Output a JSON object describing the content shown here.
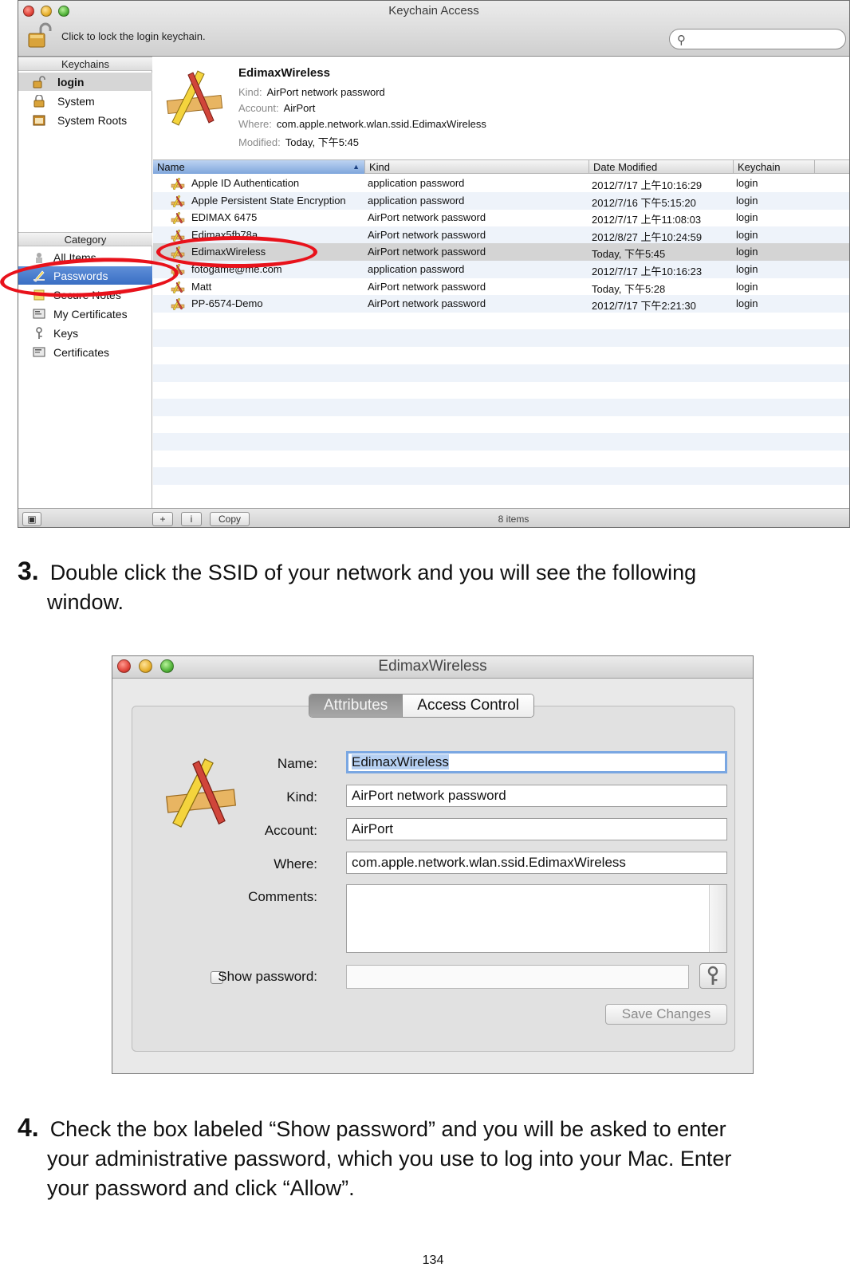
{
  "keychain_window": {
    "title": "Keychain Access",
    "lock_text": "Click to lock the login keychain.",
    "search_placeholder": "",
    "keychains_header": "Keychains",
    "keychains": [
      {
        "label": "login",
        "icon": "lock-open-icon",
        "selected": true
      },
      {
        "label": "System",
        "icon": "lock-icon",
        "selected": false
      },
      {
        "label": "System Roots",
        "icon": "folder-icon",
        "selected": false
      }
    ],
    "category_header": "Category",
    "categories": [
      {
        "label": "All Items",
        "icon": "all-items-icon",
        "selected": false
      },
      {
        "label": "Passwords",
        "icon": "pencil-icon",
        "selected": true
      },
      {
        "label": "Secure Notes",
        "icon": "note-icon",
        "selected": false
      },
      {
        "label": "My Certificates",
        "icon": "certificate-icon",
        "selected": false
      },
      {
        "label": "Keys",
        "icon": "key-icon",
        "selected": false
      },
      {
        "label": "Certificates",
        "icon": "certificate-icon",
        "selected": false
      }
    ],
    "detail": {
      "title": "EdimaxWireless",
      "kind_label": "Kind:",
      "kind": "AirPort network password",
      "account_label": "Account:",
      "account": "AirPort",
      "where_label": "Where:",
      "where": "com.apple.network.wlan.ssid.EdimaxWireless",
      "modified_label": "Modified:",
      "modified": "Today, 下午5:45"
    },
    "columns": [
      "Name",
      "Kind",
      "Date Modified",
      "Keychain"
    ],
    "rows": [
      {
        "name": "Apple ID Authentication",
        "kind": "application password",
        "date": "2012/7/17 上午10:16:29",
        "keychain": "login"
      },
      {
        "name": "Apple Persistent State Encryption",
        "kind": "application password",
        "date": "2012/7/16 下午5:15:20",
        "keychain": "login"
      },
      {
        "name": "EDIMAX 6475",
        "kind": "AirPort network password",
        "date": "2012/7/17 上午11:08:03",
        "keychain": "login"
      },
      {
        "name": "Edimax5fb78a",
        "kind": "AirPort network password",
        "date": "2012/8/27 上午10:24:59",
        "keychain": "login"
      },
      {
        "name": "EdimaxWireless",
        "kind": "AirPort network password",
        "date": "Today, 下午5:45",
        "keychain": "login",
        "selected": true
      },
      {
        "name": "fotogame@me.com",
        "kind": "application password",
        "date": "2012/7/17 上午10:16:23",
        "keychain": "login"
      },
      {
        "name": "Matt",
        "kind": "AirPort network password",
        "date": "Today, 下午5:28",
        "keychain": "login"
      },
      {
        "name": "PP-6574-Demo",
        "kind": "AirPort network password",
        "date": "2012/7/17 下午2:21:30",
        "keychain": "login"
      }
    ],
    "bottom": {
      "add": "+",
      "info": "i",
      "copy": "Copy",
      "count": "8 items"
    },
    "annotation_color": "#e8121b",
    "accent": "#3a6fc4"
  },
  "step3": {
    "number": "3.",
    "text_line1": "Double click the SSID of your network and you will see the following",
    "text_line2": "window."
  },
  "dialog": {
    "title": "EdimaxWireless",
    "tabs": [
      "Attributes",
      "Access Control"
    ],
    "name_label": "Name:",
    "name_value": "EdimaxWireless",
    "kind_label": "Kind:",
    "kind_value": "AirPort network password",
    "account_label": "Account:",
    "account_value": "AirPort",
    "where_label": "Where:",
    "where_value": "com.apple.network.wlan.ssid.EdimaxWireless",
    "comments_label": "Comments:",
    "show_password_label": "Show password:",
    "save_label": "Save Changes"
  },
  "step4": {
    "number": "4.",
    "line1": "Check the box labeled “Show password” and you will be asked to enter",
    "line2": "your administrative password, which you use to log into your Mac. Enter",
    "line3": "your password and click “Allow”."
  },
  "page_number": "134"
}
